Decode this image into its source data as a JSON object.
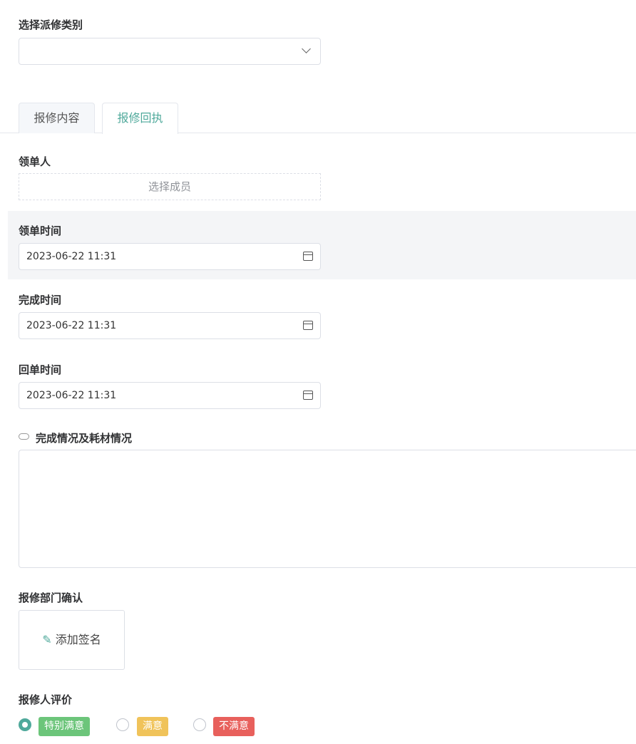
{
  "category": {
    "label": "选择派修类别",
    "value": ""
  },
  "tabs": [
    {
      "label": "报修内容",
      "active": false
    },
    {
      "label": "报修回执",
      "active": true
    }
  ],
  "assignee": {
    "label": "领单人",
    "placeholder": "选择成员"
  },
  "claim_time": {
    "label": "领单时间",
    "value": "2023-06-22 11:31"
  },
  "finish_time": {
    "label": "完成时间",
    "value": "2023-06-22 11:31"
  },
  "return_time": {
    "label": "回单时间",
    "value": "2023-06-22 11:31"
  },
  "completion": {
    "label": "完成情况及耗材情况",
    "value": ""
  },
  "dept_confirm": {
    "label": "报修部门确认",
    "button": "添加签名"
  },
  "rating": {
    "label": "报修人评价",
    "selected": 0,
    "options": [
      {
        "label": "特别满意",
        "color": "#6cc57a"
      },
      {
        "label": "满意",
        "color": "#f0c35a"
      },
      {
        "label": "不满意",
        "color": "#e8605c"
      }
    ]
  },
  "colors": {
    "accent": "#4fa99b"
  }
}
